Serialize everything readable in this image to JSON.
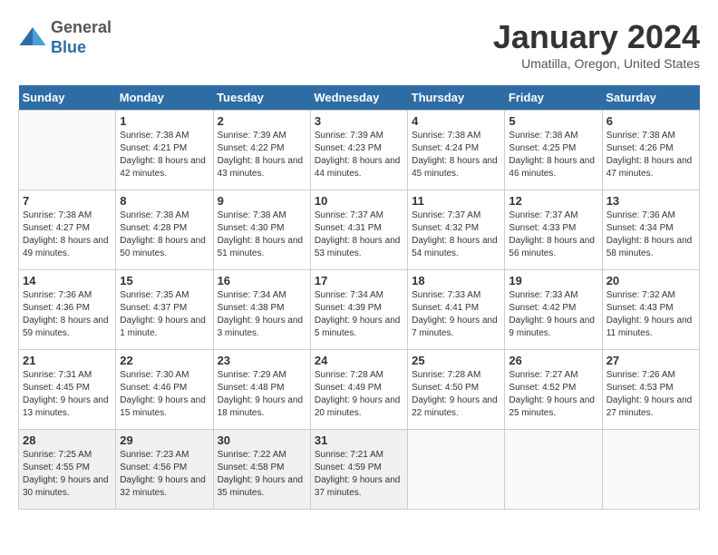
{
  "header": {
    "logo": {
      "general": "General",
      "blue": "Blue"
    },
    "title": "January 2024",
    "location": "Umatilla, Oregon, United States"
  },
  "days_of_week": [
    "Sunday",
    "Monday",
    "Tuesday",
    "Wednesday",
    "Thursday",
    "Friday",
    "Saturday"
  ],
  "weeks": [
    [
      {
        "date": "",
        "info": null
      },
      {
        "date": "1",
        "info": {
          "sunrise": "7:38 AM",
          "sunset": "4:21 PM",
          "daylight": "8 hours and 42 minutes."
        }
      },
      {
        "date": "2",
        "info": {
          "sunrise": "7:39 AM",
          "sunset": "4:22 PM",
          "daylight": "8 hours and 43 minutes."
        }
      },
      {
        "date": "3",
        "info": {
          "sunrise": "7:39 AM",
          "sunset": "4:23 PM",
          "daylight": "8 hours and 44 minutes."
        }
      },
      {
        "date": "4",
        "info": {
          "sunrise": "7:38 AM",
          "sunset": "4:24 PM",
          "daylight": "8 hours and 45 minutes."
        }
      },
      {
        "date": "5",
        "info": {
          "sunrise": "7:38 AM",
          "sunset": "4:25 PM",
          "daylight": "8 hours and 46 minutes."
        }
      },
      {
        "date": "6",
        "info": {
          "sunrise": "7:38 AM",
          "sunset": "4:26 PM",
          "daylight": "8 hours and 47 minutes."
        }
      }
    ],
    [
      {
        "date": "7",
        "info": {
          "sunrise": "7:38 AM",
          "sunset": "4:27 PM",
          "daylight": "8 hours and 49 minutes."
        }
      },
      {
        "date": "8",
        "info": {
          "sunrise": "7:38 AM",
          "sunset": "4:28 PM",
          "daylight": "8 hours and 50 minutes."
        }
      },
      {
        "date": "9",
        "info": {
          "sunrise": "7:38 AM",
          "sunset": "4:30 PM",
          "daylight": "8 hours and 51 minutes."
        }
      },
      {
        "date": "10",
        "info": {
          "sunrise": "7:37 AM",
          "sunset": "4:31 PM",
          "daylight": "8 hours and 53 minutes."
        }
      },
      {
        "date": "11",
        "info": {
          "sunrise": "7:37 AM",
          "sunset": "4:32 PM",
          "daylight": "8 hours and 54 minutes."
        }
      },
      {
        "date": "12",
        "info": {
          "sunrise": "7:37 AM",
          "sunset": "4:33 PM",
          "daylight": "8 hours and 56 minutes."
        }
      },
      {
        "date": "13",
        "info": {
          "sunrise": "7:36 AM",
          "sunset": "4:34 PM",
          "daylight": "8 hours and 58 minutes."
        }
      }
    ],
    [
      {
        "date": "14",
        "info": {
          "sunrise": "7:36 AM",
          "sunset": "4:36 PM",
          "daylight": "8 hours and 59 minutes."
        }
      },
      {
        "date": "15",
        "info": {
          "sunrise": "7:35 AM",
          "sunset": "4:37 PM",
          "daylight": "9 hours and 1 minute."
        }
      },
      {
        "date": "16",
        "info": {
          "sunrise": "7:34 AM",
          "sunset": "4:38 PM",
          "daylight": "9 hours and 3 minutes."
        }
      },
      {
        "date": "17",
        "info": {
          "sunrise": "7:34 AM",
          "sunset": "4:39 PM",
          "daylight": "9 hours and 5 minutes."
        }
      },
      {
        "date": "18",
        "info": {
          "sunrise": "7:33 AM",
          "sunset": "4:41 PM",
          "daylight": "9 hours and 7 minutes."
        }
      },
      {
        "date": "19",
        "info": {
          "sunrise": "7:33 AM",
          "sunset": "4:42 PM",
          "daylight": "9 hours and 9 minutes."
        }
      },
      {
        "date": "20",
        "info": {
          "sunrise": "7:32 AM",
          "sunset": "4:43 PM",
          "daylight": "9 hours and 11 minutes."
        }
      }
    ],
    [
      {
        "date": "21",
        "info": {
          "sunrise": "7:31 AM",
          "sunset": "4:45 PM",
          "daylight": "9 hours and 13 minutes."
        }
      },
      {
        "date": "22",
        "info": {
          "sunrise": "7:30 AM",
          "sunset": "4:46 PM",
          "daylight": "9 hours and 15 minutes."
        }
      },
      {
        "date": "23",
        "info": {
          "sunrise": "7:29 AM",
          "sunset": "4:48 PM",
          "daylight": "9 hours and 18 minutes."
        }
      },
      {
        "date": "24",
        "info": {
          "sunrise": "7:28 AM",
          "sunset": "4:49 PM",
          "daylight": "9 hours and 20 minutes."
        }
      },
      {
        "date": "25",
        "info": {
          "sunrise": "7:28 AM",
          "sunset": "4:50 PM",
          "daylight": "9 hours and 22 minutes."
        }
      },
      {
        "date": "26",
        "info": {
          "sunrise": "7:27 AM",
          "sunset": "4:52 PM",
          "daylight": "9 hours and 25 minutes."
        }
      },
      {
        "date": "27",
        "info": {
          "sunrise": "7:26 AM",
          "sunset": "4:53 PM",
          "daylight": "9 hours and 27 minutes."
        }
      }
    ],
    [
      {
        "date": "28",
        "info": {
          "sunrise": "7:25 AM",
          "sunset": "4:55 PM",
          "daylight": "9 hours and 30 minutes."
        }
      },
      {
        "date": "29",
        "info": {
          "sunrise": "7:23 AM",
          "sunset": "4:56 PM",
          "daylight": "9 hours and 32 minutes."
        }
      },
      {
        "date": "30",
        "info": {
          "sunrise": "7:22 AM",
          "sunset": "4:58 PM",
          "daylight": "9 hours and 35 minutes."
        }
      },
      {
        "date": "31",
        "info": {
          "sunrise": "7:21 AM",
          "sunset": "4:59 PM",
          "daylight": "9 hours and 37 minutes."
        }
      },
      {
        "date": "",
        "info": null
      },
      {
        "date": "",
        "info": null
      },
      {
        "date": "",
        "info": null
      }
    ]
  ],
  "labels": {
    "sunrise": "Sunrise:",
    "sunset": "Sunset:",
    "daylight": "Daylight:"
  }
}
